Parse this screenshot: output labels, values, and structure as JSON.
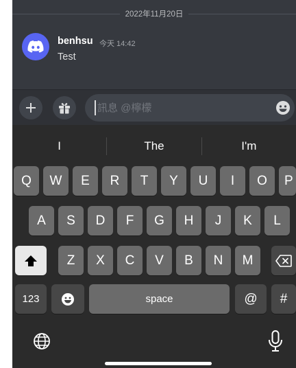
{
  "chat": {
    "date_divider": "2022年11月20日",
    "message": {
      "author": "benhsu",
      "time": "今天 14:42",
      "text": "Test"
    }
  },
  "composer": {
    "placeholder": "訊息 @檸檬"
  },
  "keyboard": {
    "suggestions": [
      "I",
      "The",
      "I'm"
    ],
    "row1": [
      "Q",
      "W",
      "E",
      "R",
      "T",
      "Y",
      "U",
      "I",
      "O",
      "P"
    ],
    "row2": [
      "A",
      "S",
      "D",
      "F",
      "G",
      "H",
      "J",
      "K",
      "L"
    ],
    "row3": [
      "Z",
      "X",
      "C",
      "V",
      "B",
      "N",
      "M"
    ],
    "numbers_label": "123",
    "space_label": "space",
    "at_label": "@",
    "hash_label": "#"
  },
  "colors": {
    "chat_bg": "#36393f",
    "accent": "#5865f2",
    "keyboard_bg": "#2b2b2b",
    "key": "#6b6b6b",
    "key_dark": "#474747"
  },
  "icons": [
    "discord-logo-icon",
    "plus-icon",
    "gift-icon",
    "emoji-icon",
    "shift-icon",
    "backspace-icon",
    "emoji-key-icon",
    "globe-icon",
    "microphone-icon"
  ]
}
